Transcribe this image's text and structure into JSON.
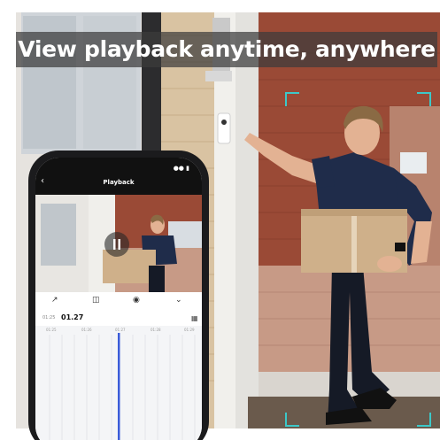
{
  "banner": {
    "text": "View playback anytime, anywhere"
  },
  "app": {
    "title": "Playback",
    "back_icon": "chevron-left-icon",
    "current_time": "01.27",
    "current_time_prefix": "01:25",
    "ticks": [
      "01:25",
      "01:26",
      "01:27",
      "01:28",
      "01:29"
    ]
  },
  "colors": {
    "banner_bg": "#3c3c3c",
    "accent_corner": "#3cc8c8",
    "timeline_cursor": "#3a5bd9",
    "shirt": "#1f2c4a",
    "box": "#cfb08a",
    "brick": "#9a4a36"
  }
}
